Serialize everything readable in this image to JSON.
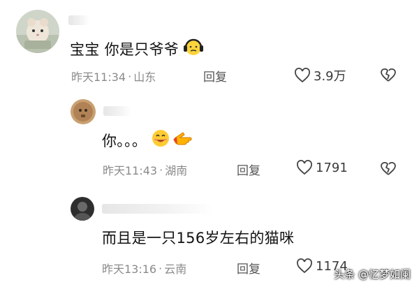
{
  "comments": [
    {
      "content": "宝宝 你是只爷爷",
      "emoji": "headphone-face-emoji",
      "time": "昨天11:34",
      "location": "山东",
      "reply_label": "回复",
      "likes": "3.9万"
    },
    {
      "content": "你。。。",
      "emoji": "smile-point-emoji",
      "time": "昨天11:43",
      "location": "湖南",
      "reply_label": "回复",
      "likes": "1791"
    },
    {
      "content": "而且是一只156岁左右的猫咪",
      "time": "昨天13:16",
      "location": "云南",
      "reply_label": "回复",
      "likes": "1174"
    }
  ],
  "watermark": "头条 @忆梦如阑",
  "colors": {
    "meta_gray": "#8a8a8a",
    "icon_gray": "#555555",
    "text": "#121212"
  }
}
